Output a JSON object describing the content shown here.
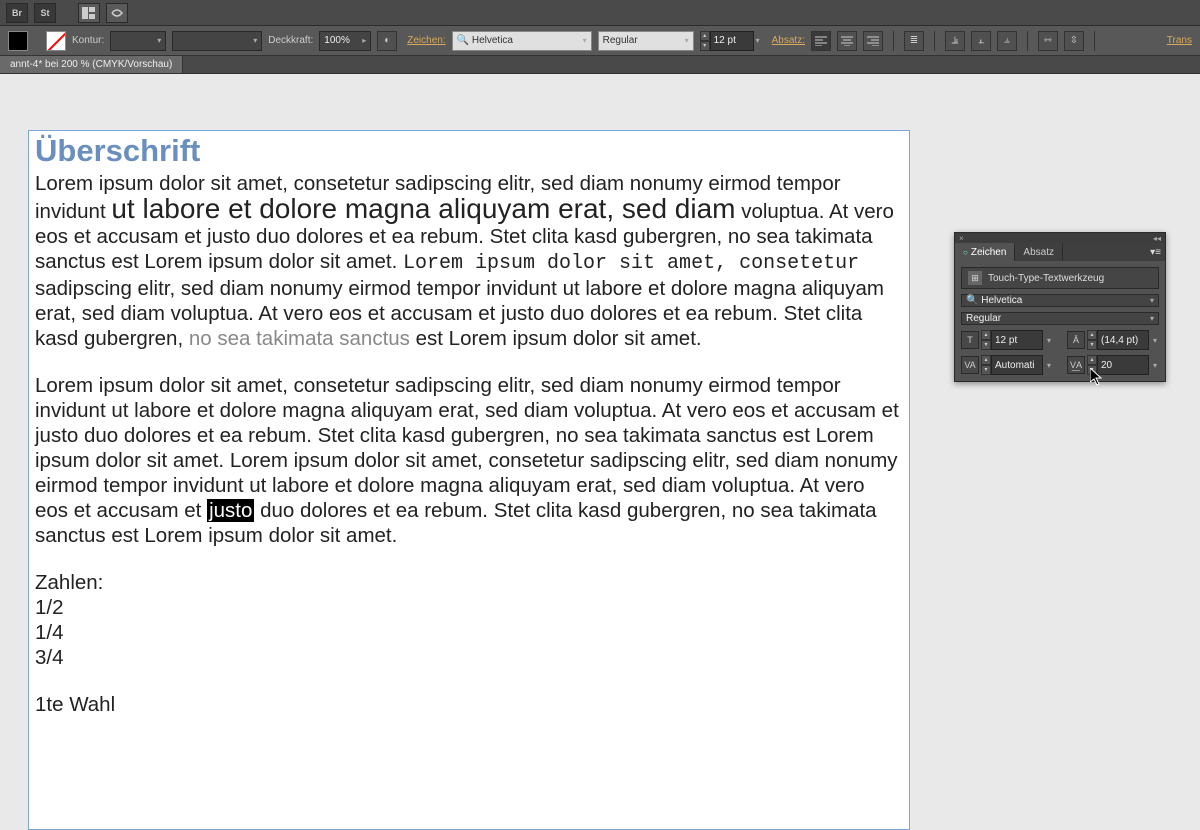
{
  "toolbar1": {
    "br": "Br",
    "st": "St"
  },
  "toolbar2": {
    "kontur_label": "Kontur:",
    "deckkraft_label": "Deckkraft:",
    "deckkraft_value": "100%",
    "zeichen_label": "Zeichen:",
    "font_family": "Helvetica",
    "font_style": "Regular",
    "font_size": "12 pt",
    "absatz_label": "Absatz:",
    "trans_label": "Trans"
  },
  "doc_tab": "annt-4* bei 200 % (CMYK/Vorschau)",
  "artboard": {
    "heading": "Überschrift",
    "p1_a": "Lorem ipsum dolor sit amet, consetetur sadipscing elitr, sed diam nonumy eirmod tempor invidunt ",
    "p1_big": "ut labore et dolore magna aliquyam erat, sed diam",
    "p1_b": " voluptua. At vero eos et accusam et justo duo dolores et ea rebum. Stet clita kasd gubergren, no sea takimata sanctus est Lorem ipsum dolor sit amet. ",
    "p1_mono": "Lorem ipsum dolor sit amet, consetetur",
    "p1_c": " sadipscing elitr, sed diam nonumy eirmod tempor invidunt ut labore et dolore magna aliquyam erat, sed diam voluptua. At vero eos et accusam et justo duo dolores et ea rebum. Stet clita kasd gubergren, ",
    "p1_grey": "no sea takimata sanctus",
    "p1_d": " est Lorem ipsum dolor sit amet.",
    "p2_a": "Lorem ipsum dolor sit amet, consetetur sadipscing elitr, sed diam nonumy eirmod tempor invidunt ut labore et dolore magna aliquyam erat, sed diam voluptua. At vero eos et accusam et justo duo dolores et ea rebum. Stet clita kasd gubergren, no sea takimata sanctus est Lorem ipsum dolor sit amet. Lorem ipsum dolor sit amet, consetetur sadipscing elitr, sed diam nonumy eirmod tempor invidunt ut labore et dolore magna aliquyam erat, sed diam voluptua. At vero eos et accusam et ",
    "p2_hl": "justo",
    "p2_b": " duo dolores et ea rebum. Stet clita kasd gubergren, no sea takimata sanctus est Lorem ipsum dolor sit amet.",
    "zahlen": "Zahlen:",
    "frac1": "1/2",
    "frac2": "1/4",
    "frac3": "3/4",
    "wahl": "1te Wahl"
  },
  "panel": {
    "tab_zeichen": "Zeichen",
    "tab_absatz": "Absatz",
    "touch_tool": "Touch-Type-Textwerkzeug",
    "font_family": "Helvetica",
    "font_style": "Regular",
    "size": "12 pt",
    "leading": "(14,4 pt)",
    "kerning": "Automati",
    "tracking": "20"
  }
}
